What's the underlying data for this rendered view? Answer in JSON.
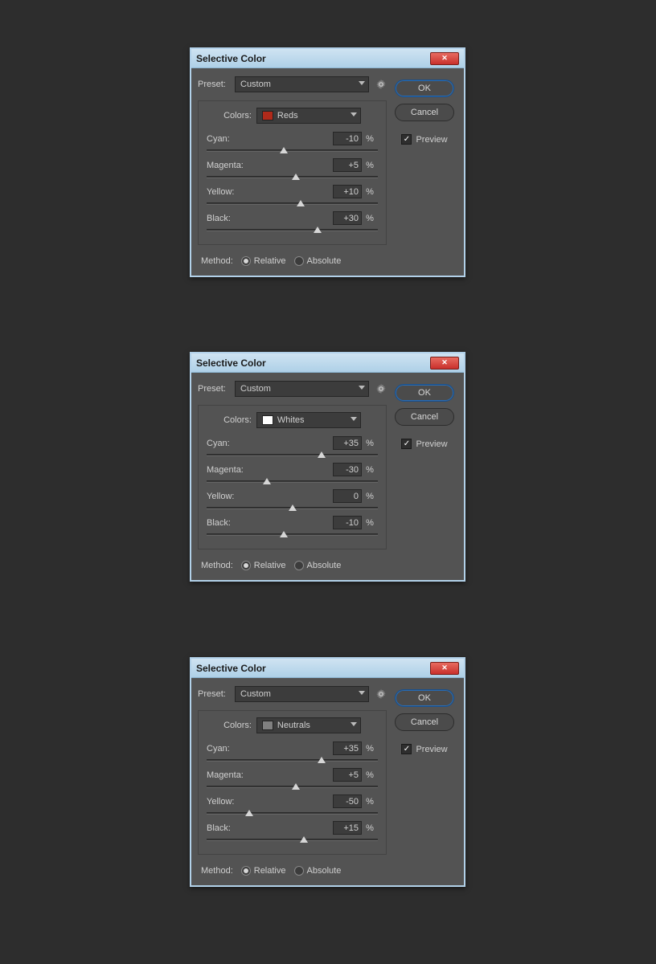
{
  "dialogs": [
    {
      "title": "Selective Color",
      "preset_label": "Preset:",
      "preset_value": "Custom",
      "colors_label": "Colors:",
      "colors_value": "Reds",
      "swatch_color": "#b02a1a",
      "channels": [
        {
          "label": "Cyan:",
          "value": "-10",
          "pos": 45
        },
        {
          "label": "Magenta:",
          "value": "+5",
          "pos": 52
        },
        {
          "label": "Yellow:",
          "value": "+10",
          "pos": 55
        },
        {
          "label": "Black:",
          "value": "+30",
          "pos": 65
        }
      ],
      "method_label": "Method:",
      "method_relative": "Relative",
      "method_absolute": "Absolute",
      "ok": "OK",
      "cancel": "Cancel",
      "preview": "Preview"
    },
    {
      "title": "Selective Color",
      "preset_label": "Preset:",
      "preset_value": "Custom",
      "colors_label": "Colors:",
      "colors_value": "Whites",
      "swatch_color": "#ffffff",
      "channels": [
        {
          "label": "Cyan:",
          "value": "+35",
          "pos": 67
        },
        {
          "label": "Magenta:",
          "value": "-30",
          "pos": 35
        },
        {
          "label": "Yellow:",
          "value": "0",
          "pos": 50
        },
        {
          "label": "Black:",
          "value": "-10",
          "pos": 45
        }
      ],
      "method_label": "Method:",
      "method_relative": "Relative",
      "method_absolute": "Absolute",
      "ok": "OK",
      "cancel": "Cancel",
      "preview": "Preview"
    },
    {
      "title": "Selective Color",
      "preset_label": "Preset:",
      "preset_value": "Custom",
      "colors_label": "Colors:",
      "colors_value": "Neutrals",
      "swatch_color": "#808080",
      "channels": [
        {
          "label": "Cyan:",
          "value": "+35",
          "pos": 67
        },
        {
          "label": "Magenta:",
          "value": "+5",
          "pos": 52
        },
        {
          "label": "Yellow:",
          "value": "-50",
          "pos": 25
        },
        {
          "label": "Black:",
          "value": "+15",
          "pos": 57
        }
      ],
      "method_label": "Method:",
      "method_relative": "Relative",
      "method_absolute": "Absolute",
      "ok": "OK",
      "cancel": "Cancel",
      "preview": "Preview"
    }
  ],
  "dialog_tops": [
    59,
    438,
    818
  ]
}
